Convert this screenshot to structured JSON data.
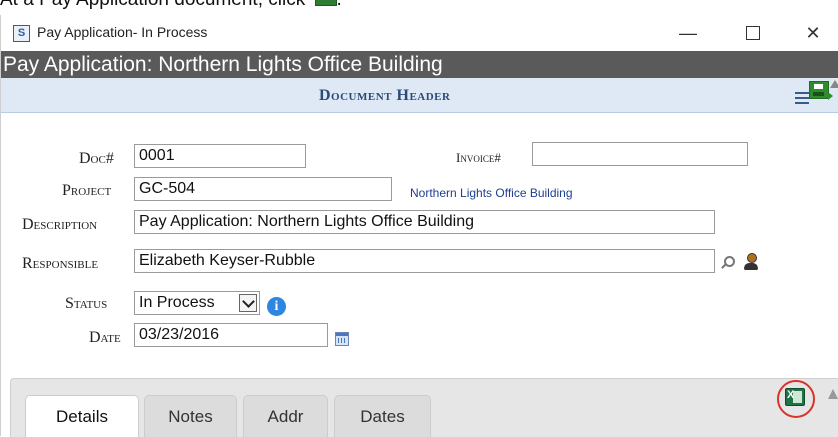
{
  "instruction": {
    "text": "At a Pay Application document, click",
    "icon": "excel-export-icon"
  },
  "window": {
    "title": "Pay Application- In Process",
    "app_icon_letter": "S",
    "controls": {
      "minimize": "—",
      "maximize": "",
      "close": "✕"
    }
  },
  "document": {
    "title": "Pay Application: Northern Lights Office Building",
    "section_header": "Document Header"
  },
  "form": {
    "doc_label": "Doc#",
    "doc_value": "0001",
    "invoice_label": "Invoice#",
    "invoice_value": "",
    "project_label": "Project",
    "project_value": "GC-504",
    "project_name": "Northern Lights Office Building",
    "description_label": "Description",
    "description_value": "Pay Application: Northern Lights Office Building",
    "responsible_label": "Responsible",
    "responsible_value": "Elizabeth Keyser-Rubble",
    "status_label": "Status",
    "status_value": "In Process",
    "date_label": "Date",
    "date_value": "03/23/2016"
  },
  "tabs": [
    {
      "label": "Details",
      "active": true
    },
    {
      "label": "Notes",
      "active": false
    },
    {
      "label": "Addr",
      "active": false
    },
    {
      "label": "Dates",
      "active": false
    }
  ],
  "colors": {
    "title_bar": "#5a5a5a",
    "header_strip": "#dfe9f5",
    "highlight_ring": "#d9342b",
    "excel_green": "#217346"
  }
}
